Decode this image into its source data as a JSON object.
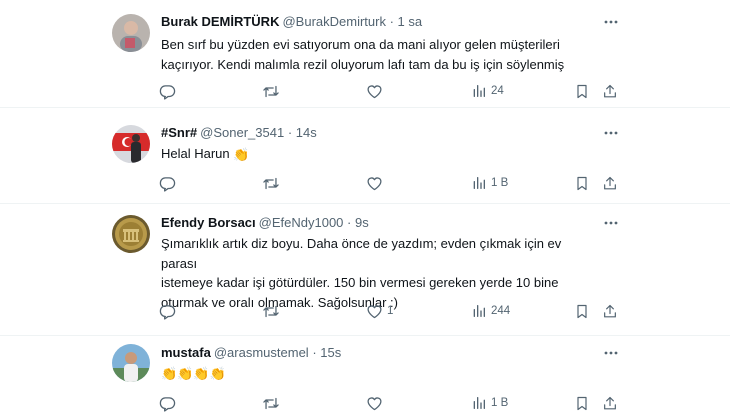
{
  "tweets": [
    {
      "name": "Burak DEMİRTÜRK",
      "handle": "@BurakDemirturk",
      "time": "· 1 sa",
      "lines": [
        "Ben sırf bu yüzden evi satıyorum ona da mani alıyor gelen müşterileri",
        "kaçırıyor. Kendi malımla rezil oluyorum lafı tam da bu iş için söylenmiş"
      ],
      "emoji": "",
      "counts": {
        "reply": "",
        "retweet": "",
        "like": "",
        "views": "24"
      }
    },
    {
      "name": "#Snr#",
      "handle": "@Soner_3541",
      "time": "· 14s",
      "lines": [
        "Helal Harun"
      ],
      "emoji": "👏",
      "counts": {
        "reply": "",
        "retweet": "",
        "like": "",
        "views": "1 B"
      }
    },
    {
      "name": "Efendy Borsacı",
      "handle": "@EfeNdy1000",
      "time": "· 9s",
      "lines": [
        "Şımarıklık artık diz boyu. Daha önce de yazdım; evden çıkmak için ev parası",
        "istemeye kadar işi götürdüler. 150 bin vermesi gereken yerde 10 bine",
        "oturmak ve oralı olmamak. Sağolsunlar :)"
      ],
      "emoji": "",
      "counts": {
        "reply": "",
        "retweet": "",
        "like": "1",
        "views": "244"
      }
    },
    {
      "name": "mustafa",
      "handle": "@arasmustemel",
      "time": "· 15s",
      "lines": [
        ""
      ],
      "emoji": "👏👏👏👏",
      "counts": {
        "reply": "",
        "retweet": "",
        "like": "",
        "views": "1 B"
      }
    }
  ],
  "icons": {
    "reply": "reply-icon",
    "retweet": "retweet-icon",
    "like": "heart-icon",
    "views": "views-icon",
    "bookmark": "bookmark-icon",
    "share": "share-icon",
    "more": "more-icon"
  },
  "colors": {
    "text": "#0f1419",
    "secondary": "#536471",
    "border": "#eff3f4"
  }
}
